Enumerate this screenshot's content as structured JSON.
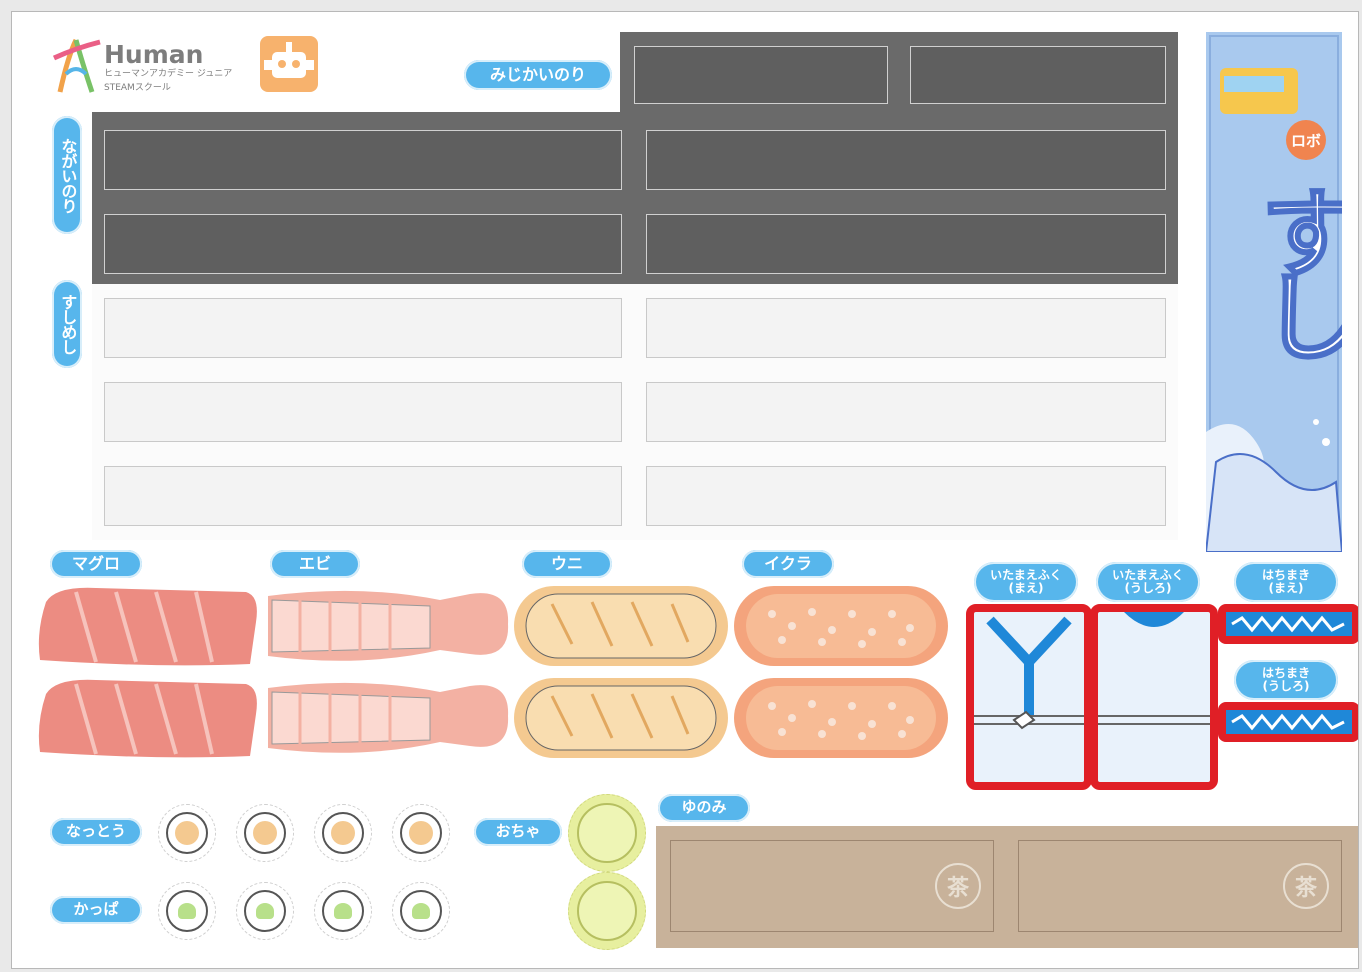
{
  "brand": {
    "name": "Human",
    "subtitle_line1": "ヒューマンアカデミー ジュニア",
    "subtitle_line2": "STEAMスクール"
  },
  "labels": {
    "short_nori": "みじかいのり",
    "long_nori": "ながいのり",
    "sushi_rice": "すしめし",
    "maguro": "マグロ",
    "ebi": "エビ",
    "uni": "ウニ",
    "ikura": "イクラ",
    "itamae_front": "いたまえふく\n(まえ)",
    "itamae_back": "いたまえふく\n(うしろ)",
    "hachimaki_front": "はちまき\n(まえ)",
    "hachimaki_back": "はちまき\n(うしろ)",
    "natto": "なっとう",
    "kappa": "かっぱ",
    "ocha": "おちゃ",
    "yunomi": "ゆのみ"
  },
  "banner": {
    "title": "すし",
    "badge": "ロボ"
  },
  "yunomi_marks": [
    "茶",
    "茶"
  ],
  "colors": {
    "label_blue": "#57b6ec",
    "nori": "#6a6a6a",
    "tuna": "#ec8c82",
    "shrimp": "#f3b1a3",
    "uni": "#f4c990",
    "ikura": "#f4a47d",
    "outline_red": "#e01f26",
    "yunomi": "#c8b29a",
    "robot": "#f7b26d",
    "banner": "#a9c9ee"
  },
  "icons": {
    "logo": "human-figure-logo",
    "robot": "robot-icon"
  }
}
